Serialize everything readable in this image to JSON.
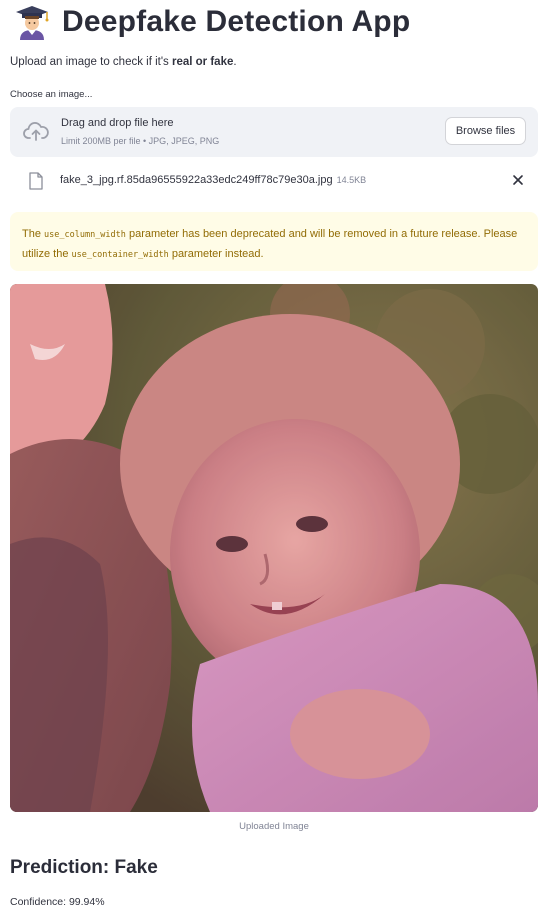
{
  "header": {
    "icon": "scientist-emoji-icon",
    "title": "Deepfake Detection App"
  },
  "intro": {
    "text_before": "Upload an image to check if it's ",
    "bold": "real or fake",
    "text_after": "."
  },
  "uploader": {
    "label": "Choose an image...",
    "drop_title": "Drag and drop file here",
    "drop_hint": "Limit 200MB per file • JPG, JPEG, PNG",
    "browse_label": "Browse files",
    "file": {
      "name": "fake_3_jpg.rf.85da96555922a33edc249ff78c79e30a.jpg",
      "size": "14.5KB"
    }
  },
  "warning": {
    "t1": "The ",
    "code1": "use_column_width",
    "t2": " parameter has been deprecated and will be removed in a future release. Please utilize the ",
    "code2": "use_container_width",
    "t3": " parameter instead."
  },
  "image": {
    "caption": "Uploaded Image"
  },
  "result": {
    "prediction": "Prediction: Fake",
    "confidence": "Confidence: 99.94%"
  },
  "colors": {
    "dropzone_bg": "#f0f2f6",
    "warning_bg": "#fffce7",
    "warning_text": "#926c05"
  }
}
